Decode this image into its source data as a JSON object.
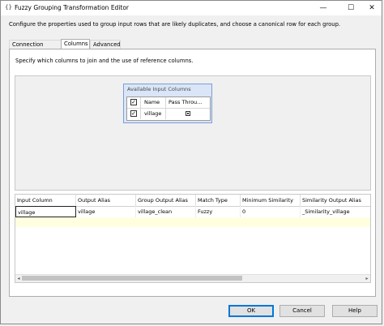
{
  "window": {
    "title": "Fuzzy Grouping Transformation Editor"
  },
  "description": "Configure the properties used to group input rows that are likely duplicates, and choose a canonical row for each group.",
  "tabs": [
    {
      "label": "Connection Manager",
      "active": false
    },
    {
      "label": "Columns",
      "active": true
    },
    {
      "label": "Advanced",
      "active": false
    }
  ],
  "instructions": "Specify which columns to join and the use of reference columns.",
  "available_columns": {
    "title": "Available Input Columns",
    "headers": [
      "Name",
      "Pass Throu..."
    ],
    "rows": [
      {
        "name": "village",
        "selected": true,
        "pass_through": true
      }
    ]
  },
  "grid": {
    "headers": [
      "Input Column",
      "Output Alias",
      "Group Output Alias",
      "Match Type",
      "Minimum Similarity",
      "Similarity Output Alias"
    ],
    "rows": [
      [
        "village",
        "village",
        "village_clean",
        "Fuzzy",
        "0",
        "_Similarity_village"
      ]
    ]
  },
  "buttons": {
    "ok": "OK",
    "cancel": "Cancel",
    "help": "Help"
  },
  "icons": {
    "close": "✕",
    "maximize": "☐",
    "minimize": "—",
    "app": "{}",
    "scroll_left": "◂",
    "scroll_right": "▸"
  }
}
